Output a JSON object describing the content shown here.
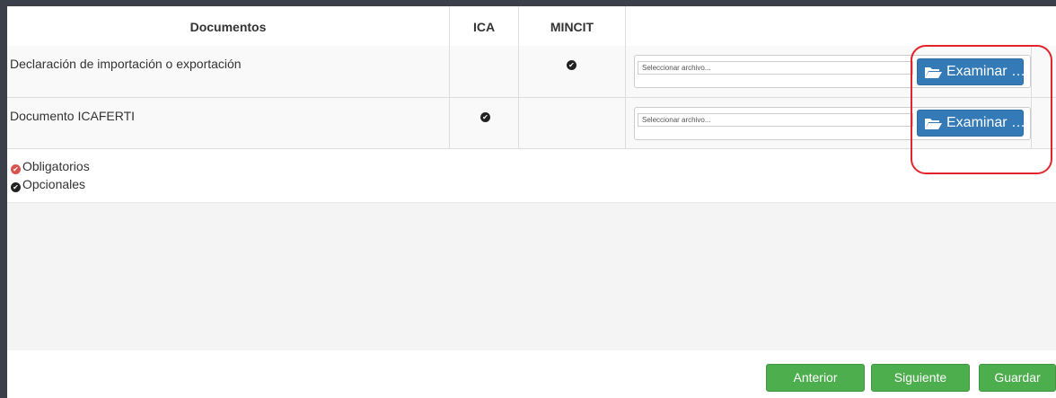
{
  "table": {
    "headers": {
      "documentos": "Documentos",
      "ica": "ICA",
      "mincit": "MINCIT"
    },
    "rows": [
      {
        "label": "Declaración de importación o exportación",
        "ica_required": false,
        "mincit_required": true,
        "file_placeholder": "Seleccionar archivo...",
        "browse_label": "Examinar …"
      },
      {
        "label": "Documento ICAFERTI",
        "ica_required": true,
        "mincit_required": false,
        "file_placeholder": "Seleccionar archivo...",
        "browse_label": "Examinar …"
      }
    ]
  },
  "legend": {
    "required_label": "Obligatorios",
    "optional_label": "Opcionales",
    "required_color": "#d9534f",
    "optional_color": "#222222"
  },
  "buttons": {
    "previous": "Anterior",
    "next": "Siguiente",
    "save": "Guardar"
  },
  "colors": {
    "primary": "#337ab7",
    "success": "#4cae4c",
    "highlight": "#e3242b"
  }
}
